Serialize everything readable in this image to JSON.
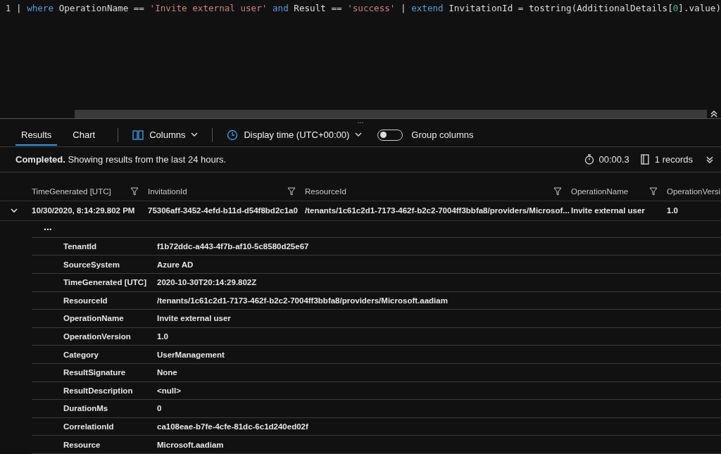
{
  "editor": {
    "line_number": "1",
    "tokens": [
      {
        "kind": "pipe",
        "text": "|"
      },
      {
        "kind": "keyword",
        "text": "where"
      },
      {
        "kind": "plain",
        "text": "OperationName =="
      },
      {
        "kind": "string",
        "text": "'Invite external user'"
      },
      {
        "kind": "keyword",
        "text": "and"
      },
      {
        "kind": "plain",
        "text": "Result =="
      },
      {
        "kind": "string",
        "text": "'success'"
      },
      {
        "kind": "pipe",
        "text": "|"
      },
      {
        "kind": "keyword",
        "text": "extend"
      },
      {
        "kind": "plain",
        "text": "InvitationId = tostring(AdditionalDetails["
      },
      {
        "kind": "number",
        "text": "0"
      },
      {
        "kind": "plain",
        "text": "].value)"
      }
    ]
  },
  "splitter": {
    "handle": "..."
  },
  "tabs": [
    {
      "label": "Results",
      "selected": true
    },
    {
      "label": "Chart",
      "selected": false
    }
  ],
  "toolbar": {
    "columns": "Columns",
    "display_time": "Display time (UTC+00:00)",
    "group_columns": {
      "label": "Group columns",
      "on": false
    }
  },
  "status": {
    "bold": "Completed.",
    "message": "Showing results from the last 24 hours.",
    "duration": "00:00.3",
    "records": "1 records"
  },
  "table": {
    "columns": [
      "TimeGenerated [UTC]",
      "InvitationId",
      "ResourceId",
      "OperationName",
      "OperationVersi"
    ],
    "rows": [
      {
        "expanded": true,
        "cells": [
          "10/30/2020, 8:14:29.802 PM",
          "75306aff-3452-4efd-b11d-d54f8bd2c1a0",
          "/tenants/1c61c2d1-7173-462f-b2c2-7004ff3bbfa8/providers/Microsof...",
          "Invite external user",
          "1.0"
        ],
        "more": "...",
        "details": [
          {
            "key": "TenantId",
            "value": "f1b72ddc-a443-4f7b-af10-5c8580d25e67"
          },
          {
            "key": "SourceSystem",
            "value": "Azure AD"
          },
          {
            "key": "TimeGenerated [UTC]",
            "value": "2020-10-30T20:14:29.802Z"
          },
          {
            "key": "ResourceId",
            "value": "/tenants/1c61c2d1-7173-462f-b2c2-7004ff3bbfa8/providers/Microsoft.aadiam"
          },
          {
            "key": "OperationName",
            "value": "Invite external user"
          },
          {
            "key": "OperationVersion",
            "value": "1.0"
          },
          {
            "key": "Category",
            "value": "UserManagement"
          },
          {
            "key": "ResultSignature",
            "value": "None"
          },
          {
            "key": "ResultDescription",
            "value": "<null>"
          },
          {
            "key": "DurationMs",
            "value": "0"
          },
          {
            "key": "CorrelationId",
            "value": "ca108eae-b7fe-4cfe-81dc-6c1d240ed02f"
          },
          {
            "key": "Resource",
            "value": "Microsoft.aadiam"
          }
        ]
      }
    ]
  }
}
